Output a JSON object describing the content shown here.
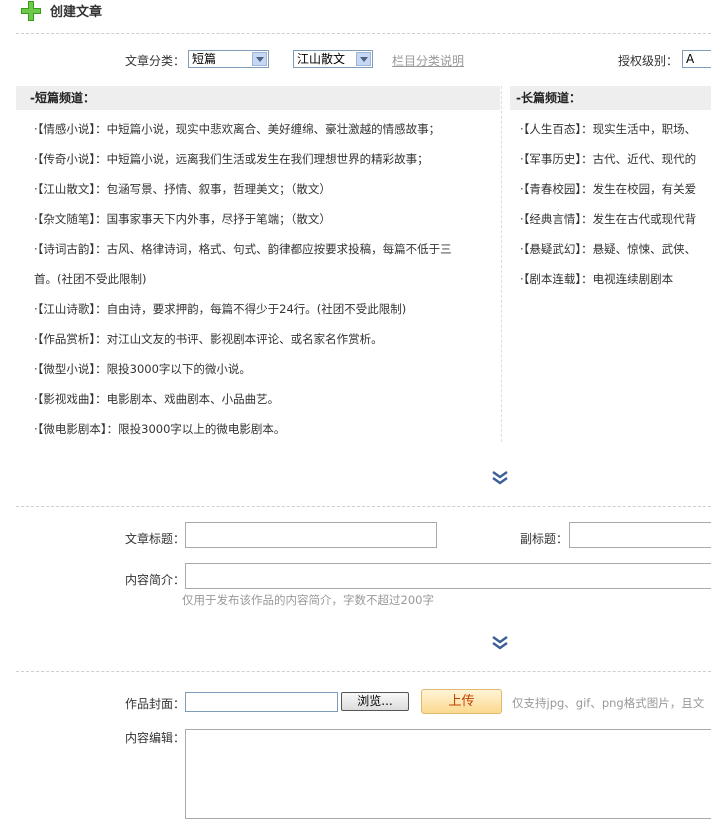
{
  "page": {
    "title": "创建文章"
  },
  "filters": {
    "category_label": "文章分类：",
    "category_value": "短篇",
    "subcategory_value": "江山散文",
    "category_help_link": "栏目分类说明",
    "permission_label": "授权级别：",
    "permission_value": "A"
  },
  "short_channel": {
    "header": "-短篇频道：",
    "items": [
      {
        "name": "·【情感小说】",
        "desc": "：中短篇小说，现实中悲欢离合、美好缠绵、豪壮激越的情感故事；"
      },
      {
        "name": "·【传奇小说】",
        "desc": "：中短篇小说，远离我们生活或发生在我们理想世界的精彩故事；"
      },
      {
        "name": "·【江山散文】",
        "desc": "：包涵写景、抒情、叙事，哲理美文；（散文）"
      },
      {
        "name": "·【杂文随笔】",
        "desc": "：国事家事天下内外事，尽抒于笔端；（散文）"
      },
      {
        "name": "·【诗词古韵】",
        "desc": "：古风、格律诗词，格式、句式、韵律都应按要求投稿，每篇不低于三",
        "desc2": "首。(社团不受此限制)"
      },
      {
        "name": "·【江山诗歌】",
        "desc": "：自由诗，要求押韵，每篇不得少于24行。(社团不受此限制)"
      },
      {
        "name": "·【作品赏析】",
        "desc": "：对江山文友的书评、影视剧本评论、或名家名作赏析。"
      },
      {
        "name": "·【微型小说】",
        "desc": "：限投3000字以下的微小说。"
      },
      {
        "name": "·【影视戏曲】",
        "desc": "：电影剧本、戏曲剧本、小品曲艺。"
      },
      {
        "name": "·【微电影剧本】",
        "desc": "：限投3000字以上的微电影剧本。"
      }
    ]
  },
  "long_channel": {
    "header": "-长篇频道：",
    "items": [
      {
        "name": "·【人生百态】",
        "desc": "：现实生活中，职场、"
      },
      {
        "name": "·【军事历史】",
        "desc": "：古代、近代、现代的"
      },
      {
        "name": "·【青春校园】",
        "desc": "：发生在校园，有关爱"
      },
      {
        "name": "·【经典言情】",
        "desc": "：发生在古代或现代背"
      },
      {
        "name": "·【悬疑武幻】",
        "desc": "：悬疑、惊悚、武侠、"
      },
      {
        "name": "·【剧本连载】",
        "desc": "：电视连续剧剧本"
      }
    ]
  },
  "form": {
    "title_label": "文章标题：",
    "subtitle_label": "副标题：",
    "summary_label": "内容简介：",
    "summary_hint": "仅用于发布该作品的内容简介，字数不超过200字",
    "cover_label": "作品封面：",
    "browse_button": "浏览...",
    "upload_button": "上传",
    "cover_hint": "仅支持jpg、gif、png格式图片，且文",
    "editor_label": "内容编辑："
  },
  "colors": {
    "accent_green": "#3a9a1a",
    "header_bg": "#eeeeee",
    "link_gray": "#999999",
    "expand_blue": "#3d5f97",
    "upload_bg": "#fde7b7"
  }
}
